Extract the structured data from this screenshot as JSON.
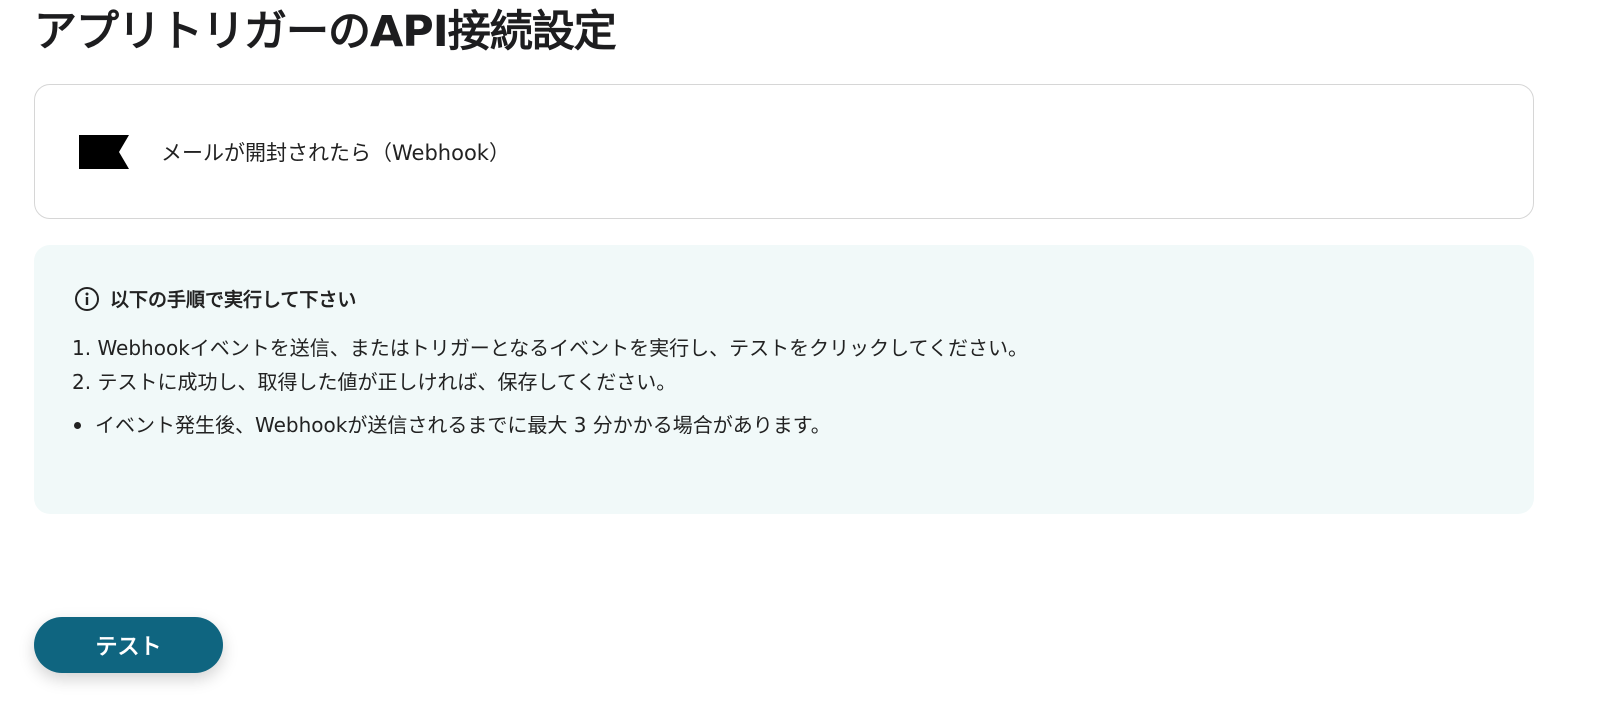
{
  "page": {
    "title": "アプリトリガーのAPI接続設定"
  },
  "trigger_card": {
    "label": "メールが開封されたら（Webhook）",
    "logo_icon": "flag-logo-icon"
  },
  "instructions": {
    "heading": "以下の手順で実行して下さい",
    "heading_icon": "info-circle-icon",
    "steps": [
      "1. Webhookイベントを送信、またはトリガーとなるイベントを実行し、テストをクリックしてください。",
      "2. テストに成功し、取得した値が正しければ、保存してください。"
    ],
    "notes": [
      "イベント発生後、Webhookが送信されるまでに最大 3 分かかる場合があります。"
    ]
  },
  "actions": {
    "test_label": "テスト"
  },
  "colors": {
    "accent": "#0f6580",
    "panel_background": "#f1f9f9",
    "card_border": "#d6d6d6"
  }
}
